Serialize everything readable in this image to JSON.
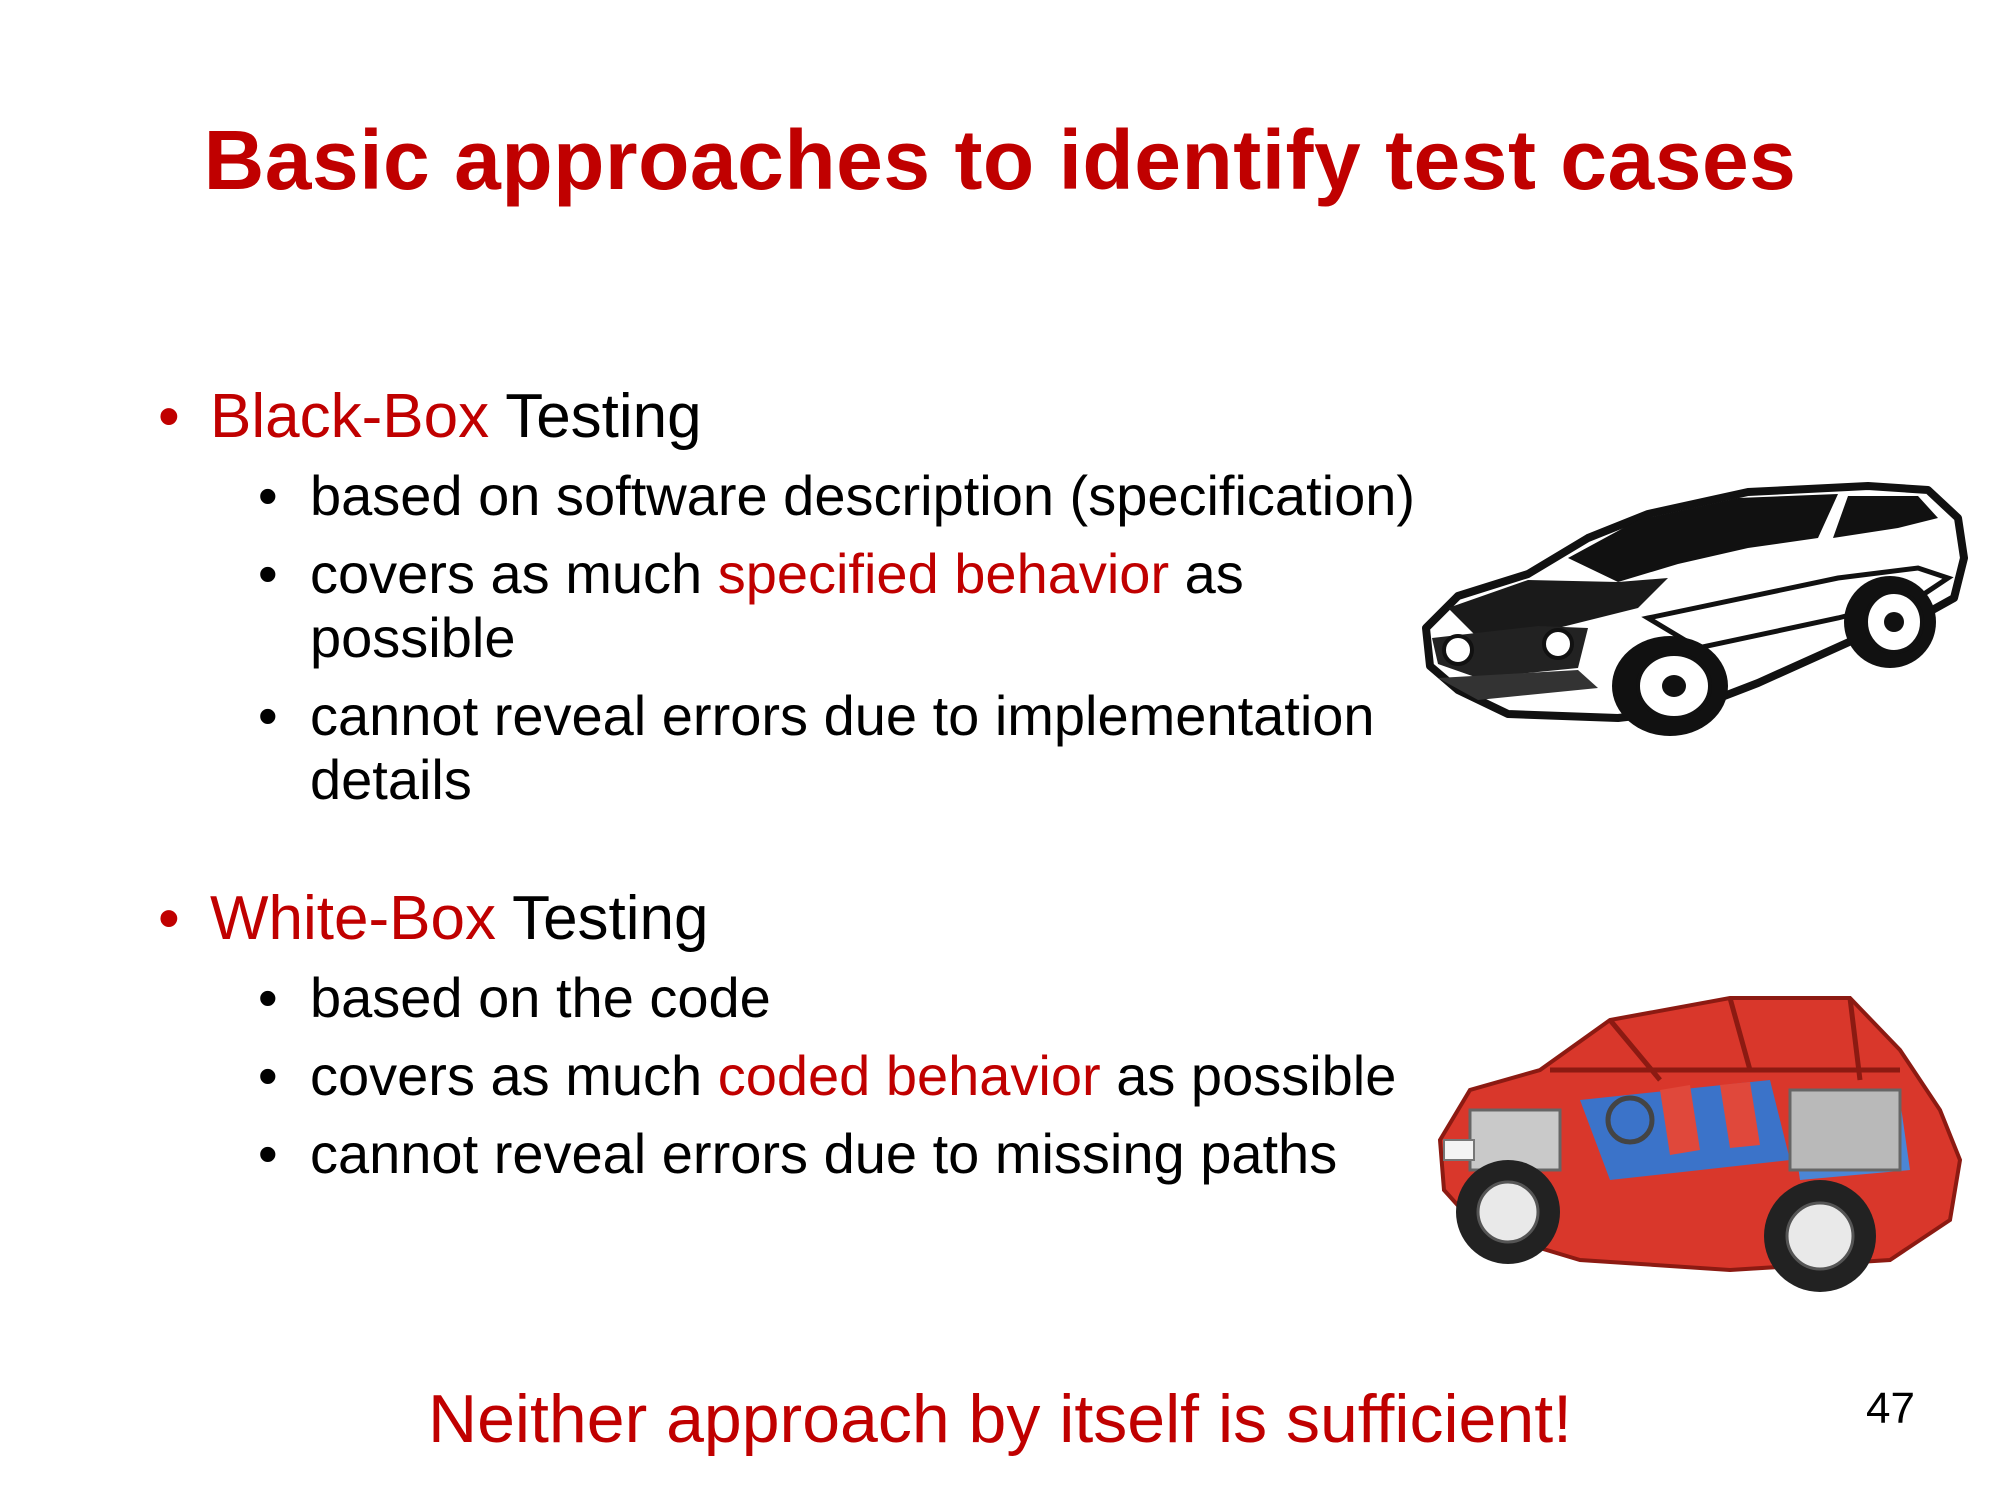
{
  "slide": {
    "title": "Basic approaches to identify test cases",
    "sections": [
      {
        "highlight": "Black-Box",
        "label": " Testing",
        "points": [
          {
            "pre": "based on software description (specification)",
            "highlight": "",
            "post": ""
          },
          {
            "pre": "covers as much ",
            "highlight": "specified behavior",
            "post": " as possible"
          },
          {
            "pre": "cannot reveal errors due to implementation details",
            "highlight": "",
            "post": ""
          }
        ]
      },
      {
        "highlight": "White-Box",
        "label": " Testing",
        "points": [
          {
            "pre": "based on the code",
            "highlight": "",
            "post": ""
          },
          {
            "pre": "covers as much ",
            "highlight": "coded behavior",
            "post": " as possible"
          },
          {
            "pre": "cannot reveal errors due to missing paths",
            "highlight": "",
            "post": ""
          }
        ]
      }
    ],
    "conclusion": "Neither approach by itself is sufficient!",
    "page_number": "47",
    "bullet": "•"
  },
  "colors": {
    "accent": "#c00000",
    "text": "#000000"
  },
  "icons": {
    "black_box": "black-sports-car-icon",
    "white_box": "red-cutaway-car-icon"
  }
}
